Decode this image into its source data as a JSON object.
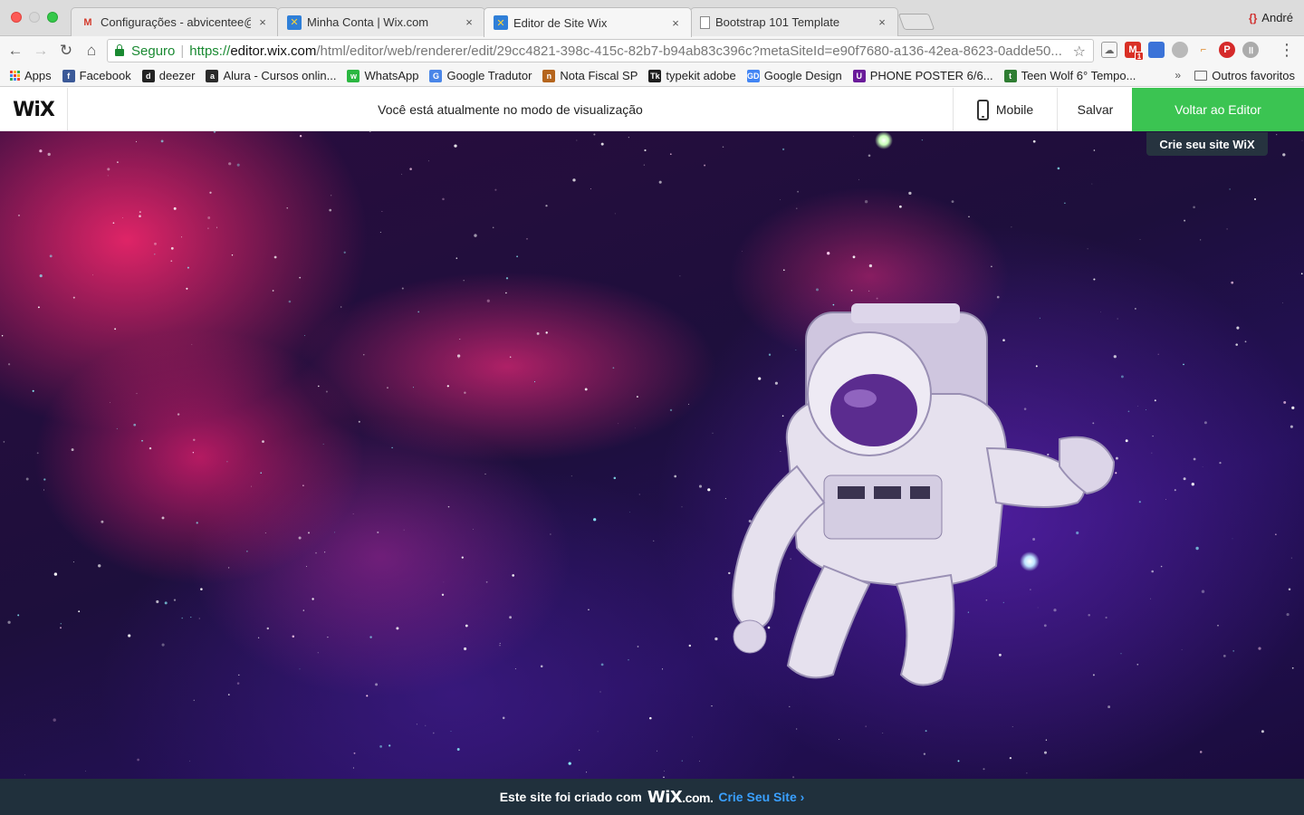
{
  "browser": {
    "user_name": "André",
    "tabs": [
      {
        "title": "Configurações - abvicentee@g",
        "icon": "gmail-icon",
        "active": false
      },
      {
        "title": "Minha Conta | Wix.com",
        "icon": "wix-icon",
        "active": false
      },
      {
        "title": "Editor de Site Wix",
        "icon": "wix-icon",
        "active": true
      },
      {
        "title": "Bootstrap 101 Template",
        "icon": "document-icon",
        "active": false
      }
    ],
    "close_glyph": "×",
    "address": {
      "secure_label": "Seguro",
      "separator": "|",
      "scheme": "https://",
      "host": "editor.wix.com",
      "path": "/html/editor/web/renderer/edit/29cc4821-398c-415c-82b7-b94ab83c396c?metaSiteId=e90f7680-a136-42ea-8623-0adde50..."
    },
    "extension_badge": "1"
  },
  "bookmarks": {
    "items": [
      {
        "label": "Apps",
        "icon": "apps-grid-icon"
      },
      {
        "label": "Facebook",
        "icon": "facebook-icon",
        "color": "#3b5998",
        "glyph": "f"
      },
      {
        "label": "deezer",
        "icon": "deezer-icon",
        "color": "#222222",
        "glyph": "d"
      },
      {
        "label": "Alura - Cursos onlin...",
        "icon": "alura-icon",
        "color": "#2b2b2b",
        "glyph": "a"
      },
      {
        "label": "WhatsApp",
        "icon": "whatsapp-icon",
        "color": "#2bb741",
        "glyph": "w"
      },
      {
        "label": "Google Tradutor",
        "icon": "google-translate-icon",
        "color": "#4a86e8",
        "glyph": "G"
      },
      {
        "label": "Nota Fiscal SP",
        "icon": "nota-fiscal-icon",
        "color": "#b5651d",
        "glyph": "n"
      },
      {
        "label": "typekit adobe",
        "icon": "typekit-icon",
        "color": "#1e1e1e",
        "glyph": "Tk"
      },
      {
        "label": "Google Design",
        "icon": "google-design-icon",
        "color": "#4285f4",
        "glyph": "GD"
      },
      {
        "label": "PHONE POSTER 6/6...",
        "icon": "phone-poster-icon",
        "color": "#6a1b9a",
        "glyph": "U"
      },
      {
        "label": "Teen Wolf 6° Tempo...",
        "icon": "teen-wolf-icon",
        "color": "#2e7d32",
        "glyph": "t"
      }
    ],
    "overflow": "»",
    "other_folder": "Outros favoritos"
  },
  "wix_bar": {
    "logo": "WiX",
    "preview_message": "Você está atualmente no modo de visualização",
    "mobile_label": "Mobile",
    "save_label": "Salvar",
    "back_to_editor_label": "Voltar ao Editor",
    "tooltip": "Crie seu site WiX"
  },
  "footer": {
    "text_before": "Este site foi criado com",
    "brand": "WiX",
    "brand_suffix": ".com.",
    "link": "Crie Seu Site ›"
  },
  "colors": {
    "accent_green": "#3bc452",
    "footer_bg": "#20303c",
    "link_blue": "#3aa0ff",
    "secure_green": "#1a8a32"
  }
}
